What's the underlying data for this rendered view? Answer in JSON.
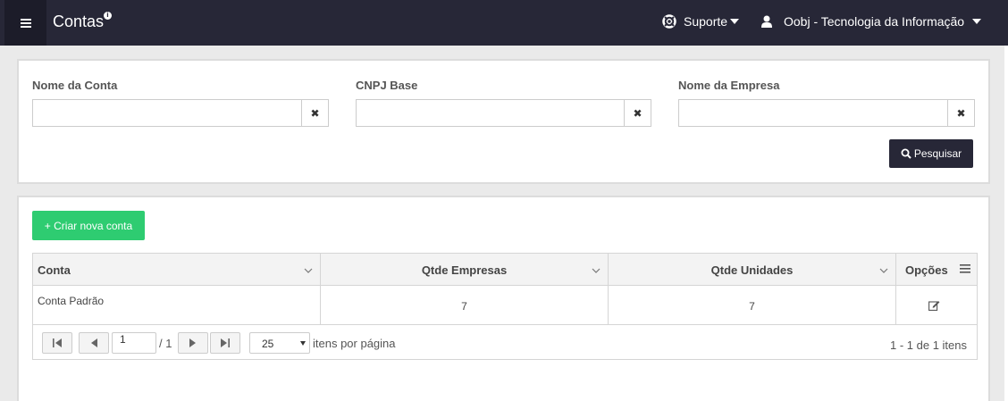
{
  "header": {
    "title": "Contas",
    "info_icon": "info-icon",
    "support_label": "Suporte",
    "user_label": "Oobj - Tecnologia da Informação",
    "background": "#272737"
  },
  "filters": {
    "account_name_label": "Nome da Conta",
    "account_name_value": "",
    "cnpj_label": "CNPJ Base",
    "cnpj_value": "",
    "company_name_label": "Nome da Empresa",
    "company_name_value": "",
    "clear_glyph": "✖",
    "search_label": "Pesquisar"
  },
  "actions": {
    "create_label": "+ Criar nova conta",
    "create_color": "#2ecc71"
  },
  "grid": {
    "columns": [
      "Conta",
      "Qtde Empresas",
      "Qtde Unidades",
      "Opções"
    ],
    "rows": [
      {
        "conta": "Conta Padrão",
        "empresas": "7",
        "unidades": "7"
      }
    ]
  },
  "pager": {
    "page": "1",
    "of": "/ 1",
    "page_size": "25",
    "per_page_label": "itens por página",
    "range": "1 - 1 de 1 itens"
  }
}
